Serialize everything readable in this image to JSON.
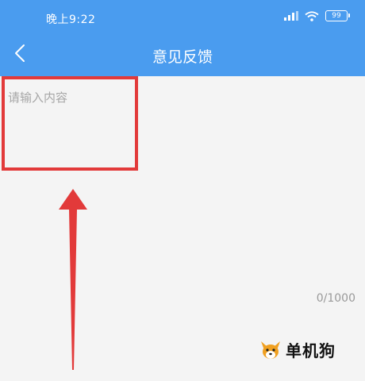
{
  "status_bar": {
    "time": "晚上9:22",
    "battery": "99"
  },
  "app_bar": {
    "title": "意见反馈",
    "back_icon": "chevron-left-icon"
  },
  "feedback": {
    "placeholder": "请输入内容",
    "value": "",
    "counter": "0/1000"
  },
  "annotation": {
    "highlight_color": "#e23a3a",
    "arrow_color": "#e23a3a"
  },
  "watermark": {
    "text": "单机狗",
    "logo": "dog-logo-icon"
  },
  "colors": {
    "header": "#4a9cef",
    "background": "#f4f4f4"
  }
}
